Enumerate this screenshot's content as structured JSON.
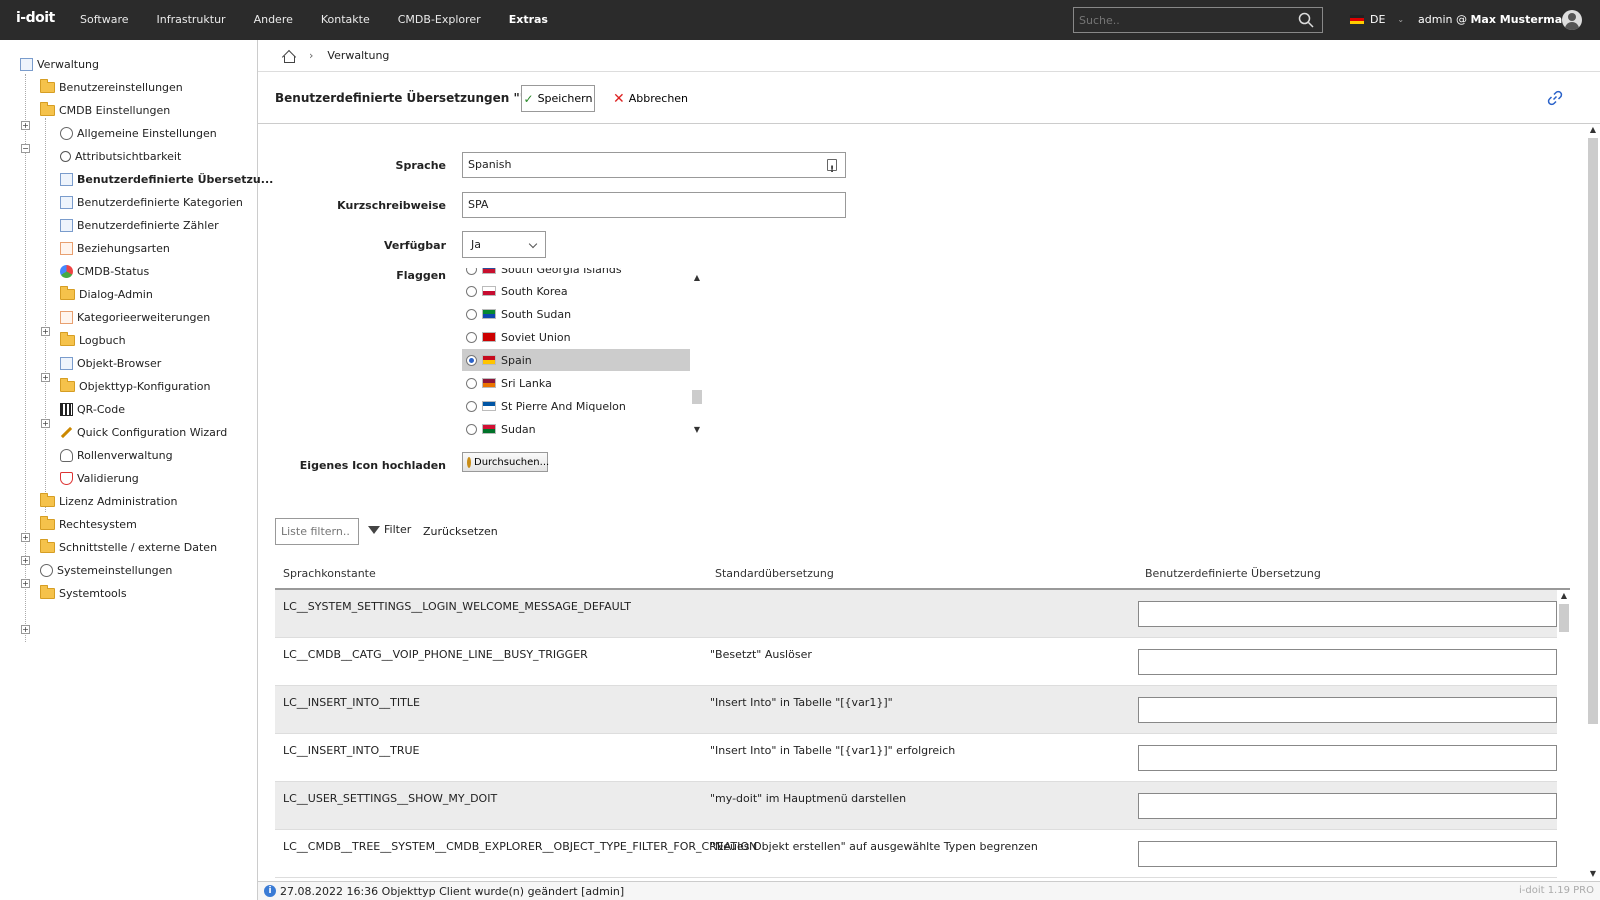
{
  "topbar": {
    "logo": "i-doit",
    "nav": [
      "Software",
      "Infrastruktur",
      "Andere",
      "Kontakte",
      "CMDB-Explorer",
      "Extras"
    ],
    "search_placeholder": "Suche..",
    "language": "DE",
    "user_prefix": "admin @ ",
    "user_name": "Max Mustermann"
  },
  "sidebar": {
    "root": "Verwaltung",
    "items": {
      "benutzereinstellungen": "Benutzereinstellungen",
      "cmdb_einstellungen": "CMDB Einstellungen",
      "allgemeine": "Allgemeine Einstellungen",
      "attribut": "Attributsichtbarkeit",
      "uebersetzungen": "Benutzerdefinierte Übersetzu...",
      "kategorien": "Benutzerdefinierte Kategorien",
      "zaehler": "Benutzerdefinierte Zähler",
      "beziehungsarten": "Beziehungsarten",
      "cmdb_status": "CMDB-Status",
      "dialog_admin": "Dialog-Admin",
      "kategorieerweiterungen": "Kategorieerweiterungen",
      "logbuch": "Logbuch",
      "objekt_browser": "Objekt-Browser",
      "objekttyp": "Objekttyp-Konfiguration",
      "qr_code": "QR-Code",
      "quick_wizard": "Quick Configuration Wizard",
      "rollen": "Rollenverwaltung",
      "validierung": "Validierung",
      "lizenz": "Lizenz Administration",
      "rechtesystem": "Rechtesystem",
      "schnittstelle": "Schnittstelle / externe Daten",
      "systemeinstellungen": "Systemeinstellungen",
      "systemtools": "Systemtools"
    }
  },
  "breadcrumb": {
    "current": "Verwaltung"
  },
  "toolbar": {
    "title": "Benutzerdefinierte Übersetzungen \"\"",
    "save_label": "Speichern",
    "cancel_label": "Abbrechen"
  },
  "form": {
    "sprache_label": "Sprache",
    "sprache_value": "Spanish",
    "kurz_label": "Kurzschreibweise",
    "kurz_value": "SPA",
    "verfuegbar_label": "Verfügbar",
    "verfuegbar_value": "Ja",
    "flaggen_label": "Flaggen",
    "flags": [
      {
        "name": "South Georgia Islands",
        "colors": [
          "#2a4d9b",
          "#c8102e"
        ]
      },
      {
        "name": "South Korea",
        "colors": [
          "#ffffff",
          "#c60c30"
        ]
      },
      {
        "name": "South Sudan",
        "colors": [
          "#078930",
          "#0f47af"
        ]
      },
      {
        "name": "Soviet Union",
        "colors": [
          "#cc0000",
          "#cc0000"
        ]
      },
      {
        "name": "Spain",
        "colors": [
          "#c60b1e",
          "#ffc400"
        ]
      },
      {
        "name": "Sri Lanka",
        "colors": [
          "#8d153a",
          "#eb7400"
        ]
      },
      {
        "name": "St Pierre And Miquelon",
        "colors": [
          "#0055a4",
          "#ffffff"
        ]
      },
      {
        "name": "Sudan",
        "colors": [
          "#d21034",
          "#007229"
        ]
      }
    ],
    "selected_flag": "Spain",
    "icon_label": "Eigenes Icon hochladen",
    "browse_label": "Durchsuchen..."
  },
  "filter": {
    "placeholder": "Liste filtern..",
    "filter_label": "Filter",
    "reset_label": "Zurücksetzen"
  },
  "table": {
    "headers": [
      "Sprachkonstante",
      "Standardübersetzung",
      "Benutzerdefinierte Übersetzung"
    ],
    "rows": [
      [
        "LC__SYSTEM_SETTINGS__LOGIN_WELCOME_MESSAGE_DEFAULT",
        ""
      ],
      [
        "LC__CMDB__CATG__VOIP_PHONE_LINE__BUSY_TRIGGER",
        "\"Besetzt\" Auslöser"
      ],
      [
        "LC__INSERT_INTO__TITLE",
        "\"Insert Into\" in Tabelle \"[{var1}]\""
      ],
      [
        "LC__INSERT_INTO__TRUE",
        "\"Insert Into\" in Tabelle \"[{var1}]\" erfolgreich"
      ],
      [
        "LC__USER_SETTINGS__SHOW_MY_DOIT",
        "\"my-doit\" im Hauptmenü darstellen"
      ],
      [
        "LC__CMDB__TREE__SYSTEM__CMDB_EXPLORER__OBJECT_TYPE_FILTER_FOR_CREATION",
        "\"Neues Objekt erstellen\" auf ausgewählte Typen begrenzen"
      ]
    ]
  },
  "status": {
    "message": "27.08.2022 16:36 Objekttyp Client wurde(n) geändert [admin]",
    "version": "i-doit 1.19 PRO"
  }
}
